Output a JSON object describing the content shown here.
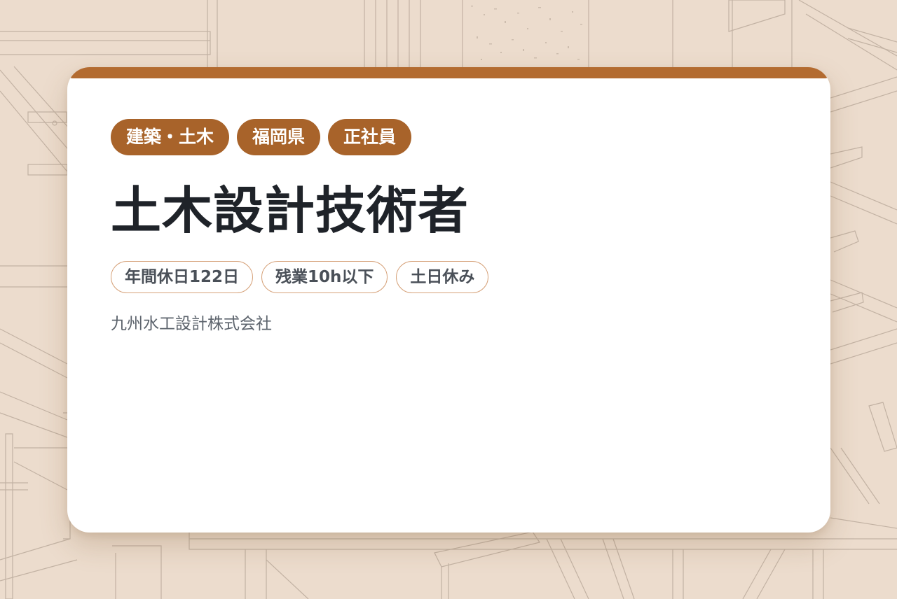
{
  "colors": {
    "background": "#ecdccd",
    "accent": "#b36b30",
    "tag_background": "#a8632a",
    "title_text": "#1f2329",
    "benefit_border": "#d6a27a",
    "benefit_text": "#4a5058",
    "company_text": "#5d646d",
    "illustration_line": "#b5a496"
  },
  "background": {
    "illustration_icon": "construction-scaffold-illustration"
  },
  "card": {
    "tags": [
      {
        "label": "建築・土木"
      },
      {
        "label": "福岡県"
      },
      {
        "label": "正社員"
      }
    ],
    "title": "土木設計技術者",
    "benefits": [
      {
        "label": "年間休日122日"
      },
      {
        "label": "残業10h以下"
      },
      {
        "label": "土日休み"
      }
    ],
    "company": "九州水工設計株式会社"
  }
}
